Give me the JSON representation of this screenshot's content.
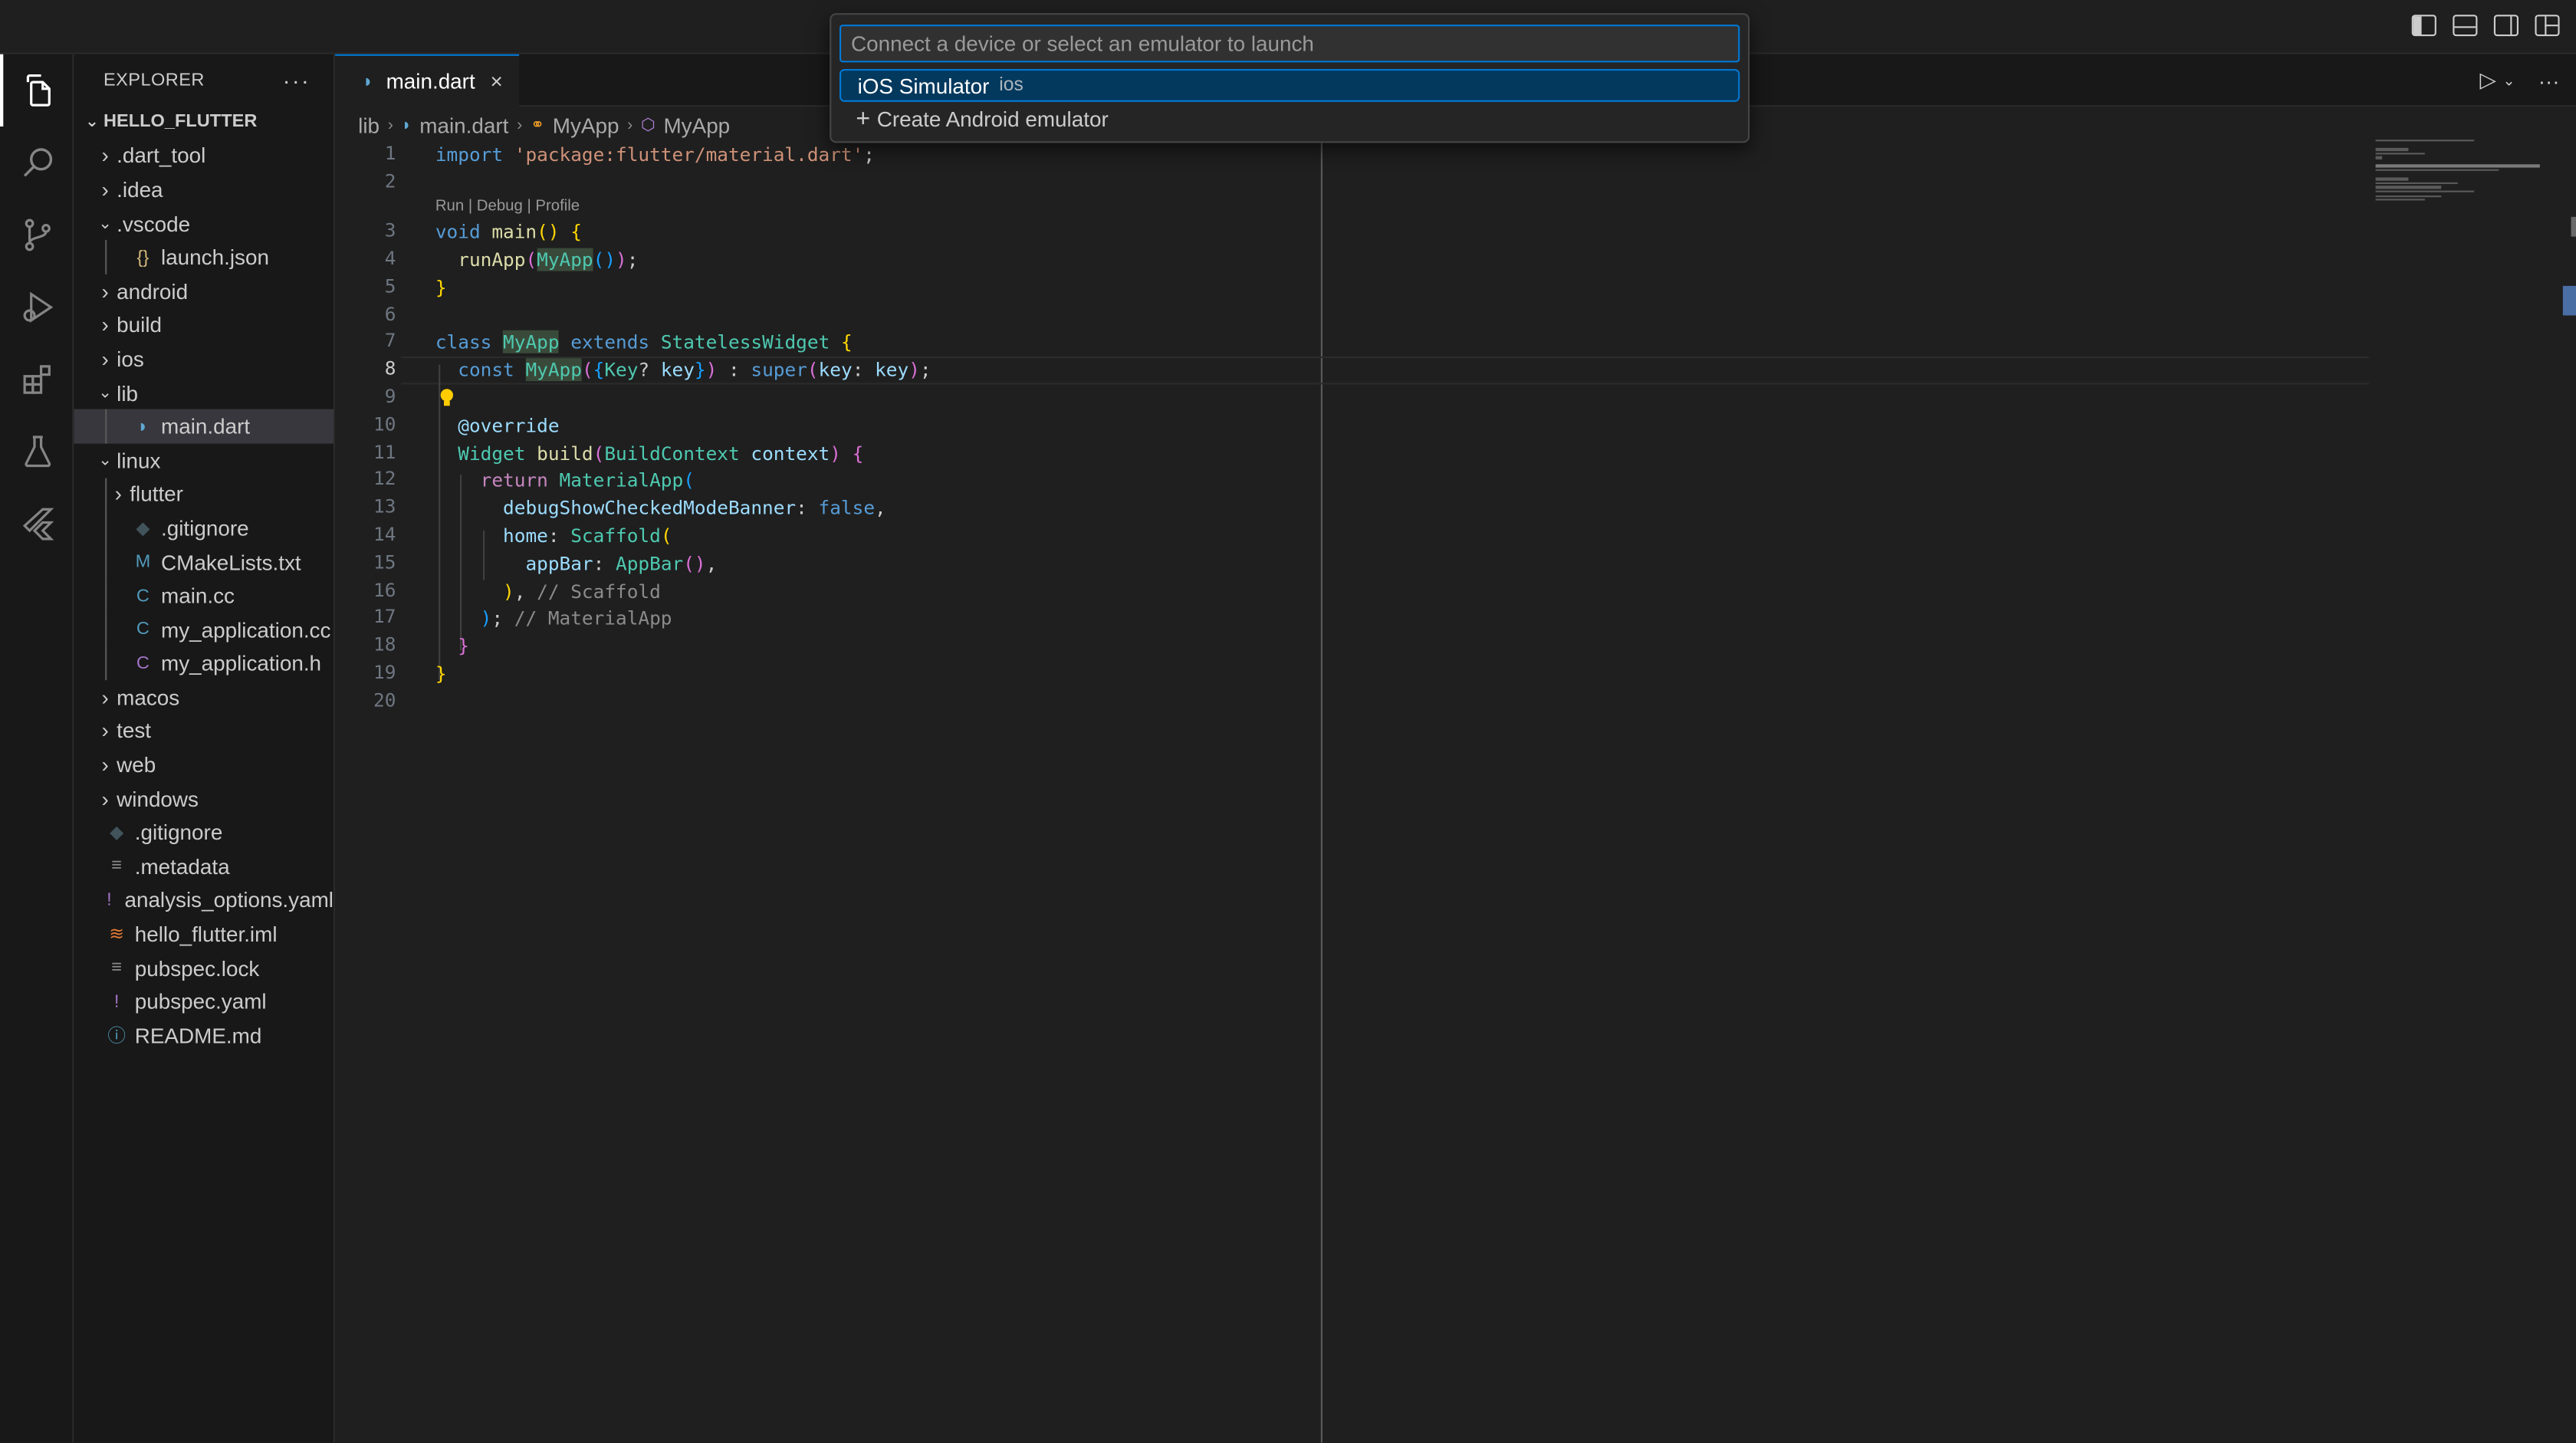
{
  "quick_pick": {
    "placeholder": "Connect a device or select an emulator to launch",
    "items": [
      {
        "label": "iOS Simulator",
        "description": "ios"
      },
      {
        "label": "Create Android emulator",
        "description": ""
      }
    ]
  },
  "activity_bar": [
    "files-icon",
    "search-icon",
    "source-control-icon",
    "run-debug-icon",
    "extensions-icon",
    "testing-icon",
    "flutter-icon"
  ],
  "explorer": {
    "header": "EXPLORER",
    "more": "···",
    "root": "HELLO_FLUTTER",
    "items": [
      {
        "label": ".dart_tool",
        "type": "folder",
        "depth": 1,
        "open": false
      },
      {
        "label": ".idea",
        "type": "folder",
        "depth": 1,
        "open": false
      },
      {
        "label": ".vscode",
        "type": "folder",
        "depth": 1,
        "open": true
      },
      {
        "label": "launch.json",
        "type": "json",
        "depth": 2
      },
      {
        "label": "android",
        "type": "folder",
        "depth": 1,
        "open": false
      },
      {
        "label": "build",
        "type": "folder",
        "depth": 1,
        "open": false
      },
      {
        "label": "ios",
        "type": "folder",
        "depth": 1,
        "open": false
      },
      {
        "label": "lib",
        "type": "folder",
        "depth": 1,
        "open": true
      },
      {
        "label": "main.dart",
        "type": "dart",
        "depth": 2,
        "selected": true
      },
      {
        "label": "linux",
        "type": "folder",
        "depth": 1,
        "open": true
      },
      {
        "label": "flutter",
        "type": "folder",
        "depth": 2,
        "open": false
      },
      {
        "label": ".gitignore",
        "type": "git",
        "depth": 2
      },
      {
        "label": "CMakeLists.txt",
        "type": "cmake",
        "depth": 2
      },
      {
        "label": "main.cc",
        "type": "cpp",
        "depth": 2
      },
      {
        "label": "my_application.cc",
        "type": "cpp",
        "depth": 2
      },
      {
        "label": "my_application.h",
        "type": "c",
        "depth": 2
      },
      {
        "label": "macos",
        "type": "folder",
        "depth": 1,
        "open": false
      },
      {
        "label": "test",
        "type": "folder",
        "depth": 1,
        "open": false
      },
      {
        "label": "web",
        "type": "folder",
        "depth": 1,
        "open": false
      },
      {
        "label": "windows",
        "type": "folder",
        "depth": 1,
        "open": false
      },
      {
        "label": ".gitignore",
        "type": "git",
        "depth": 1
      },
      {
        "label": ".metadata",
        "type": "text",
        "depth": 1
      },
      {
        "label": "analysis_options.yaml",
        "type": "yaml",
        "depth": 1
      },
      {
        "label": "hello_flutter.iml",
        "type": "rss",
        "depth": 1
      },
      {
        "label": "pubspec.lock",
        "type": "text",
        "depth": 1
      },
      {
        "label": "pubspec.yaml",
        "type": "yaml",
        "depth": 1
      },
      {
        "label": "README.md",
        "type": "info",
        "depth": 1
      }
    ]
  },
  "editor": {
    "tab_label": "main.dart",
    "tab_close": "×",
    "breadcrumb": [
      "lib",
      "main.dart",
      "MyApp",
      "MyApp"
    ],
    "codelens": "Run | Debug | Profile",
    "current_line": 8,
    "line_numbers": [
      "1",
      "2",
      "3",
      "4",
      "5",
      "6",
      "7",
      "8",
      "9",
      "10",
      "11",
      "12",
      "13",
      "14",
      "15",
      "16",
      "17",
      "18",
      "19",
      "20"
    ]
  },
  "colors": {
    "accent": "#0078d4",
    "background": "#1f1f1f",
    "sidebar": "#181818",
    "selection": "#04395e"
  }
}
